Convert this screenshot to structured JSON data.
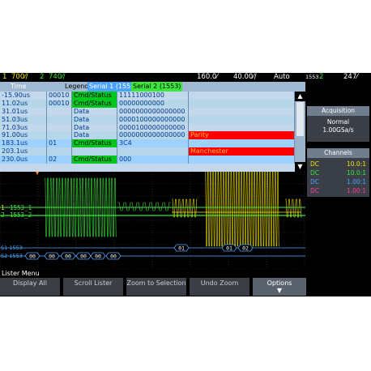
{
  "status": {
    "ch1_num": "1",
    "ch1_scale": "700⁄/",
    "ch2_num": "2",
    "ch2_scale": "740⁄/",
    "time_pos": "160.0⁄",
    "time_scale": "40.00⁄/",
    "mode": "Auto",
    "trig_src": "1553",
    "trig_ch": "2",
    "trig_level": "247⁄"
  },
  "lister": {
    "col_time": "Time",
    "legend_label": "Legend:",
    "legend1": "Serial 1 (1553)",
    "legend2": "Serial 2 (1553)",
    "rows": [
      {
        "time": "-15.90us",
        "rt": "00010",
        "type": "Cmd/Status",
        "data": "11111000100",
        "err": ""
      },
      {
        "time": "11.02us",
        "rt": "00010",
        "type": "Cmd/Status",
        "data": "00000000000",
        "err": ""
      },
      {
        "time": "31.01us",
        "rt": "",
        "type": "Data",
        "data": "0000000000000000",
        "err": ""
      },
      {
        "time": "51.03us",
        "rt": "",
        "type": "Data",
        "data": "0000100000000000",
        "err": ""
      },
      {
        "time": "71.03us",
        "rt": "",
        "type": "Data",
        "data": "0000100000000000",
        "err": ""
      },
      {
        "time": "91.00us",
        "rt": "",
        "type": "Data",
        "data": "0000000000000000",
        "err": "Parity"
      },
      {
        "time": "183.1us",
        "rt": "01",
        "type": "Cmd/Status",
        "data": "3C4",
        "err": ""
      },
      {
        "time": "203.1us",
        "rt": "",
        "type": "",
        "data": "",
        "err": "Manchester"
      },
      {
        "time": "230.0us",
        "rt": "02",
        "type": "Cmd/Status",
        "data": "000",
        "err": ""
      }
    ]
  },
  "panel": {
    "acq_title": "Acquisition",
    "acq_mode": "Normal",
    "acq_rate": "1.00GSa/s",
    "ch_title": "Channels",
    "channels": [
      {
        "coupling": "DC",
        "ratio": "10.0:1",
        "color": "#f3e100"
      },
      {
        "coupling": "DC",
        "ratio": "10.0:1",
        "color": "#3ce63c"
      },
      {
        "coupling": "DC",
        "ratio": "1.00:1",
        "color": "#4aa4ff"
      },
      {
        "coupling": "DC",
        "ratio": "1.00:1",
        "color": "#ff3d8b"
      }
    ]
  },
  "wave": {
    "ch1_label": "1553_1",
    "ch2_label": "1553_2",
    "s1_label": "S1 1553",
    "s2_label": "S2 1553",
    "ch1_num": "1",
    "ch2_num": "2",
    "bus_markers": [
      "00",
      "00",
      "00",
      "00",
      "00",
      "00",
      "01",
      "01",
      "02"
    ]
  },
  "softkeys": {
    "menu_title": "Lister Menu",
    "k1": "Display All",
    "k2": "Scroll Lister",
    "k3": "Zoom to Selection",
    "k4": "Undo Zoom",
    "k5": "Options"
  },
  "colors": {
    "ch1": "#f3e100",
    "ch2": "#3ce63c",
    "bus": "#4aa4ff",
    "cmd_bg": "#00c61e",
    "err_bg": "#ff0000"
  }
}
